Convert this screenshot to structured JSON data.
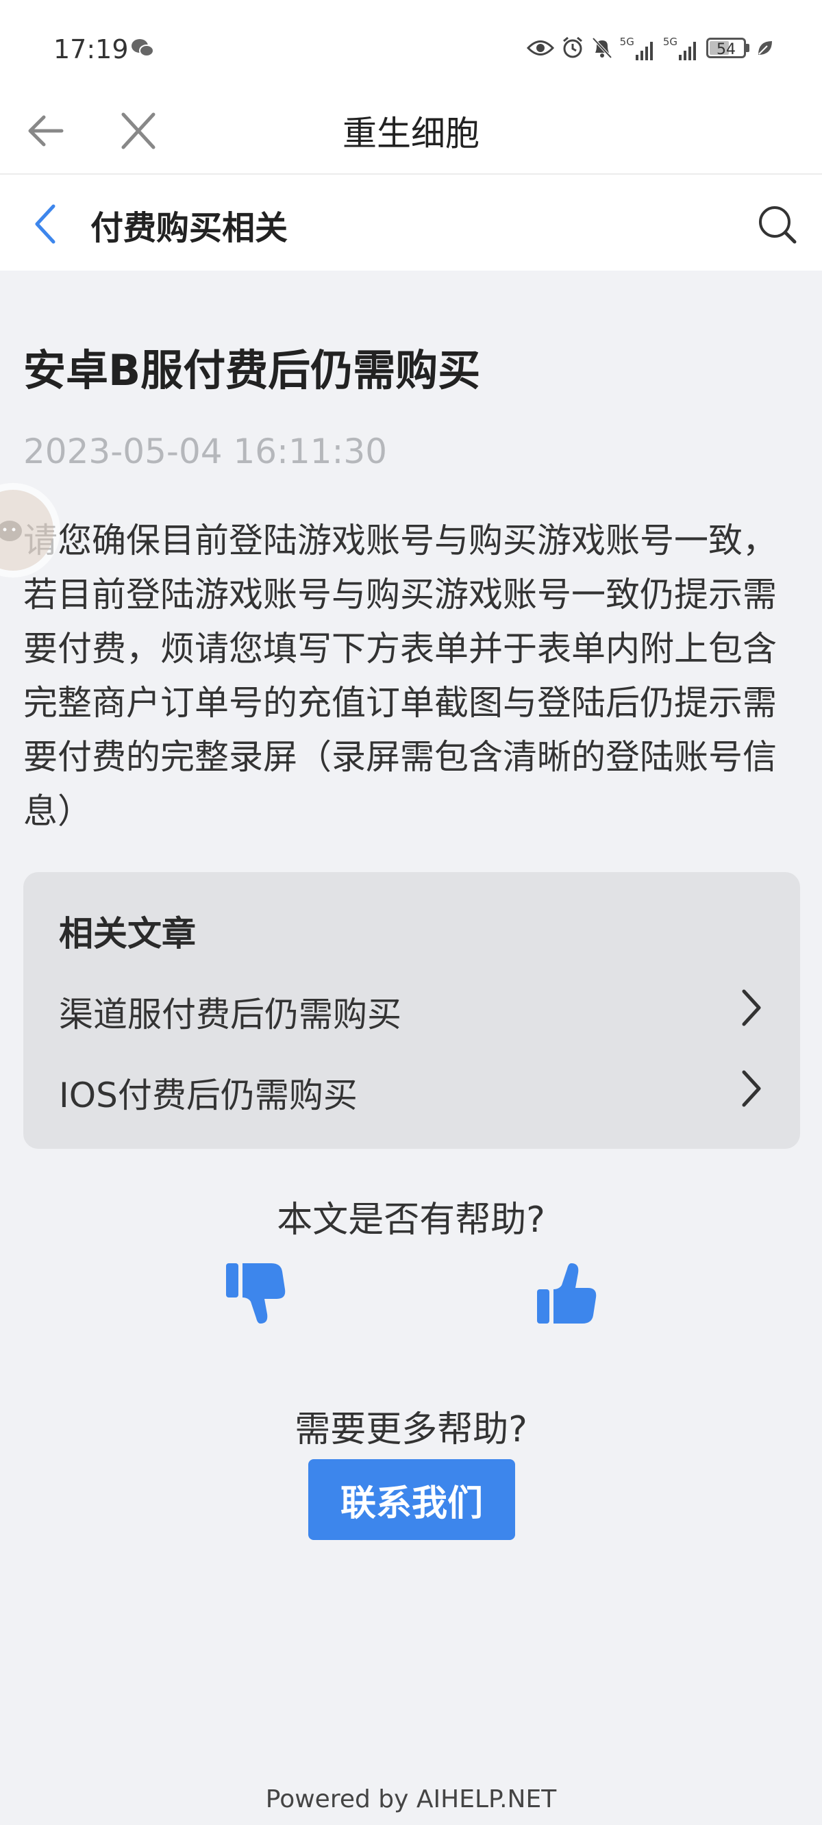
{
  "status_bar": {
    "time": "17:19",
    "network_1": "5G",
    "network_2": "5G",
    "battery": "54"
  },
  "title_bar": {
    "title": "重生细胞"
  },
  "sub_bar": {
    "label": "付费购买相关"
  },
  "article": {
    "title": "安卓B服付费后仍需购买",
    "date": "2023-05-04 16:11:30",
    "body": "请您确保目前登陆游戏账号与购买游戏账号一致，若目前登陆游戏账号与购买游戏账号一致仍提示需要付费，烦请您填写下方表单并于表单内附上包含完整商户订单号的充值订单截图与登陆后仍提示需要付费的完整录屏（录屏需包含清晰的登陆账号信息）"
  },
  "related": {
    "title": "相关文章",
    "items": [
      {
        "label": "渠道服付费后仍需购买"
      },
      {
        "label": "IOS付费后仍需购买"
      }
    ]
  },
  "feedback": {
    "question": "本文是否有帮助?"
  },
  "more_help": {
    "question": "需要更多帮助?",
    "contact_label": "联系我们"
  },
  "footer": {
    "powered_by": "Powered by AIHELP.NET"
  },
  "colors": {
    "accent": "#3d86ec",
    "background": "#f1f2f5",
    "card": "#e1e2e5"
  }
}
